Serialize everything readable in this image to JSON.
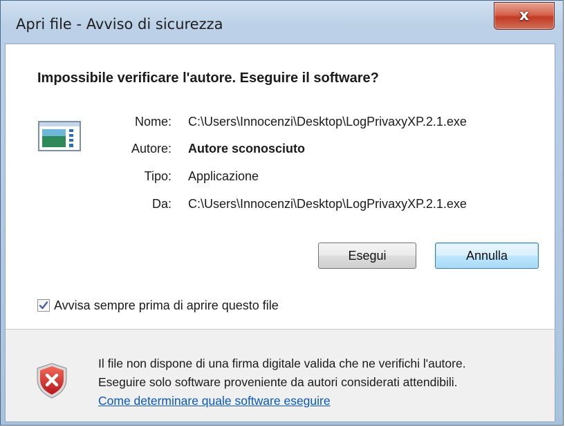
{
  "window": {
    "title": "Apri file - Avviso di sicurezza",
    "close_glyph": "x"
  },
  "dialog": {
    "question": "Impossibile verificare l'autore. Eseguire il software?",
    "details": [
      {
        "label": "Nome:",
        "value": "C:\\Users\\Innocenzi\\Desktop\\LogPrivaxyXP.2.1.exe",
        "bold": false
      },
      {
        "label": "Autore:",
        "value": "Autore sconosciuto",
        "bold": true
      },
      {
        "label": "Tipo:",
        "value": "Applicazione",
        "bold": false
      },
      {
        "label": "Da:",
        "value": "C:\\Users\\Innocenzi\\Desktop\\LogPrivaxyXP.2.1.exe",
        "bold": false
      }
    ],
    "buttons": {
      "run_label": "Esegui",
      "cancel_label": "Annulla"
    },
    "checkbox": {
      "label": "Avvisa sempre prima di aprire questo file",
      "checked": true
    },
    "footer": {
      "line1": "Il file non dispone di una firma digitale valida che ne verifichi l'autore.",
      "line2": "Eseguire solo software proveniente da autori considerati attendibili.",
      "link": "Come determinare quale software eseguire"
    }
  },
  "icons": {
    "file": "application-file-icon",
    "shield": "security-warning-shield-icon",
    "checkmark": "checkmark-icon"
  }
}
